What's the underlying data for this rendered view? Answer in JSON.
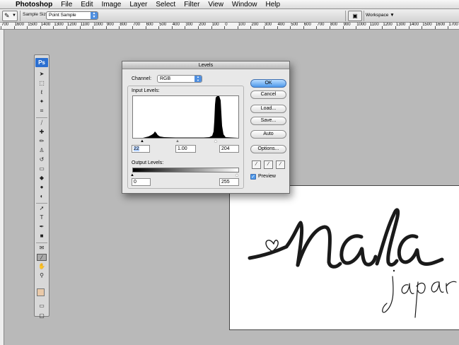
{
  "menubar": {
    "apple_glyph": "",
    "app_name": "Photoshop",
    "items": [
      "File",
      "Edit",
      "Image",
      "Layer",
      "Select",
      "Filter",
      "View",
      "Window",
      "Help"
    ]
  },
  "options": {
    "tool_glyph": "✎",
    "sample_size_label": "Sample Size:",
    "sample_size_value": "Point Sample",
    "workspace_label": "Workspace ▼"
  },
  "ruler": {
    "labels": [
      "700",
      "1600",
      "1500",
      "1400",
      "1300",
      "1200",
      "1100",
      "1000",
      "900",
      "800",
      "700",
      "600",
      "500",
      "400",
      "300",
      "200",
      "100",
      "0",
      "100",
      "200",
      "300",
      "400",
      "500",
      "600",
      "700",
      "800",
      "900",
      "1000",
      "1100",
      "1200",
      "1300",
      "1400",
      "1500",
      "1600",
      "1700"
    ]
  },
  "toolbox": {
    "logo": "Ps",
    "tools": [
      {
        "name": "move-tool",
        "glyph": "➤"
      },
      {
        "name": "marquee-tool",
        "glyph": "⬚"
      },
      {
        "name": "lasso-tool",
        "glyph": "ℓ"
      },
      {
        "name": "magic-wand-tool",
        "glyph": "✦"
      },
      {
        "name": "crop-tool",
        "glyph": "⌗"
      },
      {
        "name": "slice-tool",
        "glyph": "⧸"
      },
      {
        "name": "healing-brush-tool",
        "glyph": "✚"
      },
      {
        "name": "brush-tool",
        "glyph": "✏"
      },
      {
        "name": "clone-stamp-tool",
        "glyph": "♙"
      },
      {
        "name": "history-brush-tool",
        "glyph": "↺"
      },
      {
        "name": "eraser-tool",
        "glyph": "▭"
      },
      {
        "name": "paint-bucket-tool",
        "glyph": "◆"
      },
      {
        "name": "blur-tool",
        "glyph": "●"
      },
      {
        "name": "dodge-tool",
        "glyph": "◐"
      },
      {
        "name": "path-selection-tool",
        "glyph": "➚"
      },
      {
        "name": "type-tool",
        "glyph": "T"
      },
      {
        "name": "pen-tool",
        "glyph": "✒"
      },
      {
        "name": "shape-tool",
        "glyph": "■"
      },
      {
        "name": "notes-tool",
        "glyph": "✉"
      },
      {
        "name": "eyedropper-tool",
        "glyph": "⁄"
      },
      {
        "name": "hand-tool",
        "glyph": "✋"
      },
      {
        "name": "zoom-tool",
        "glyph": "⚲"
      }
    ],
    "colors": {
      "foreground": "#e9c9a8",
      "background": "#ffffff"
    }
  },
  "levels": {
    "title": "Levels",
    "channel_label": "Channel:",
    "channel_value": "RGB",
    "input_label": "Input Levels:",
    "input_black": "22",
    "input_gamma": "1.00",
    "input_white": "204",
    "output_label": "Output Levels:",
    "output_black": "0",
    "output_white": "255",
    "buttons": {
      "ok": "OK",
      "cancel": "Cancel",
      "load": "Load...",
      "save": "Save...",
      "auto": "Auto",
      "options": "Options..."
    },
    "preview_label": "Preview",
    "preview_checked": true
  }
}
